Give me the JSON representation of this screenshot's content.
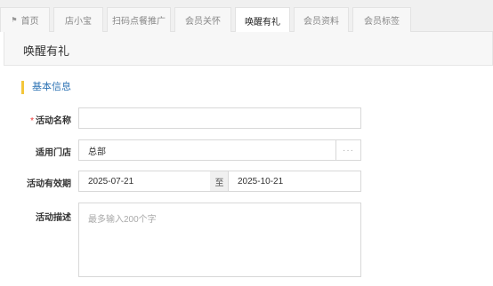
{
  "tabs": [
    {
      "label": "首页",
      "icon": "home-icon",
      "active": false
    },
    {
      "label": "店小宝",
      "active": false
    },
    {
      "label": "扫码点餐推广",
      "active": false
    },
    {
      "label": "会员关怀",
      "active": false
    },
    {
      "label": "唤醒有礼",
      "active": true
    },
    {
      "label": "会员资料",
      "active": false
    },
    {
      "label": "会员标签",
      "active": false
    }
  ],
  "page": {
    "title": "唤醒有礼"
  },
  "section": {
    "title": "基本信息",
    "accent_color": "#f3c63a",
    "title_color": "#2f74b5"
  },
  "form": {
    "activity_name": {
      "label": "活动名称",
      "required_mark": "*",
      "value": ""
    },
    "store": {
      "label": "适用门店",
      "value": "总部",
      "more_label": "···"
    },
    "period": {
      "label": "活动有效期",
      "start": "2025-07-21",
      "separator": "至",
      "end": "2025-10-21"
    },
    "description": {
      "label": "活动描述",
      "placeholder": "最多输入200个字"
    }
  }
}
